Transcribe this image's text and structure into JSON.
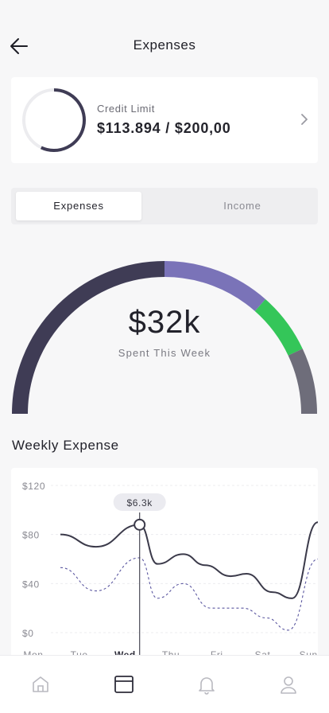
{
  "header": {
    "title": "Expenses"
  },
  "credit": {
    "label": "Credit Limit",
    "value": "$113.894 / $200,00",
    "used_fraction": 0.57
  },
  "segment": {
    "options": [
      "Expenses",
      "Income"
    ],
    "selected": "Expenses"
  },
  "gauge": {
    "amount": "$32k",
    "subtitle": "Spent This Week",
    "segments": [
      {
        "fraction": 0.5,
        "color": "#3f3c55"
      },
      {
        "fraction": 0.23,
        "color": "#7a73b8"
      },
      {
        "fraction": 0.13,
        "color": "#34c659"
      },
      {
        "fraction": 0.14,
        "color": "#6e6d7a"
      }
    ]
  },
  "weekly": {
    "title": "Weekly Expense"
  },
  "chart_data": {
    "type": "line",
    "categories": [
      "Mon",
      "Tue",
      "Wed",
      "Thu",
      "Fri",
      "Sat",
      "Sun"
    ],
    "selected_category": "Wed",
    "ylim": [
      0,
      120
    ],
    "yticks": [
      "$120",
      "$80",
      "$40",
      "$0"
    ],
    "tooltip": "$6.3k",
    "series": [
      {
        "values": [
          80,
          70,
          88,
          56,
          64,
          55,
          46,
          48,
          33,
          28,
          90
        ],
        "x": [
          0,
          0.9,
          2.0,
          2.45,
          3.1,
          3.65,
          4.3,
          4.7,
          5.35,
          5.85,
          6.5
        ],
        "style": "solid",
        "color": "#3b3a4a"
      },
      {
        "values": [
          53,
          34,
          61,
          28,
          40,
          20,
          20,
          12,
          2,
          60
        ],
        "x": [
          0,
          0.9,
          2.0,
          2.45,
          3.1,
          3.8,
          4.6,
          5.2,
          5.75,
          6.5
        ],
        "style": "dashed",
        "color": "#5b57a0"
      }
    ]
  },
  "tabbar": {
    "items": [
      "home-icon",
      "card-icon",
      "bell-icon",
      "user-icon"
    ],
    "active": "card-icon"
  }
}
